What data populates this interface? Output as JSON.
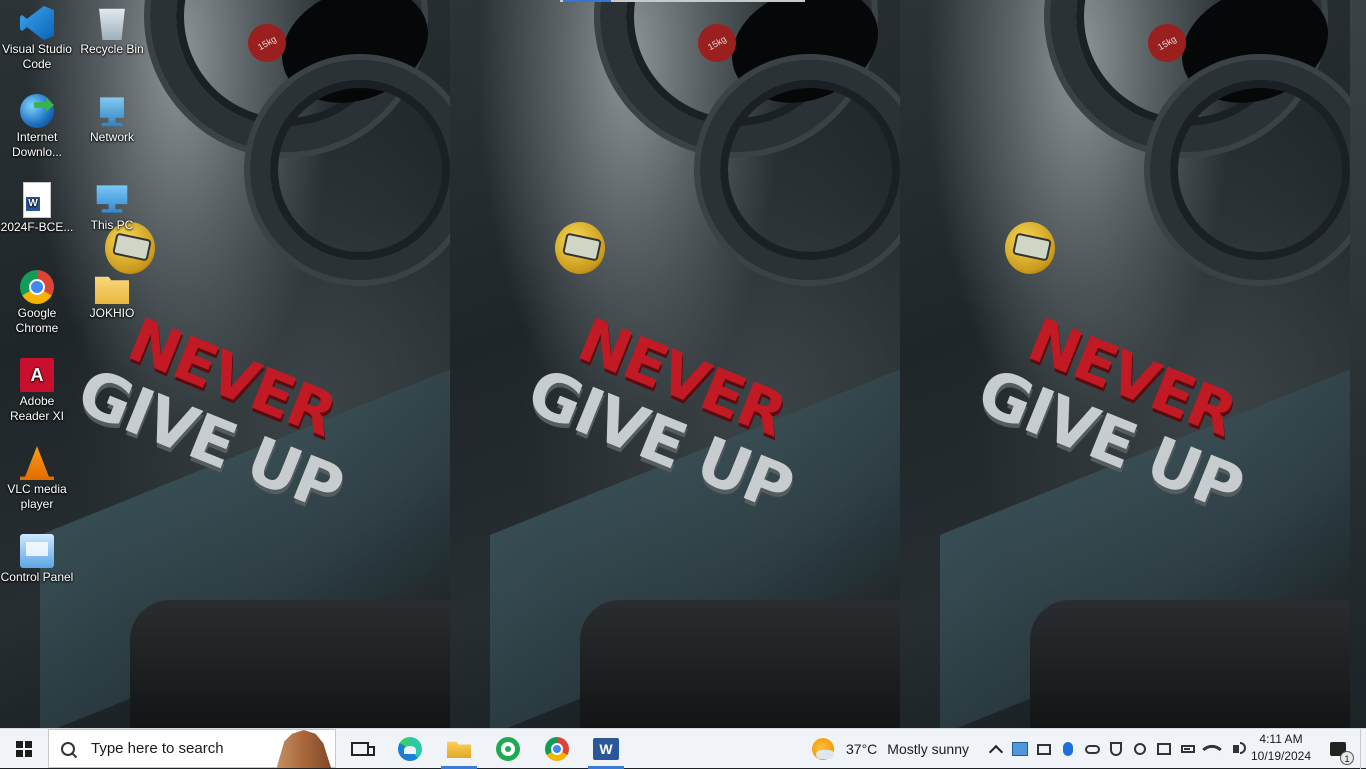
{
  "wallpaper": {
    "line1": "NEVER",
    "line2": "GIVE UP",
    "plate_label": "15kg"
  },
  "desktop_icons": [
    {
      "label": "Visual Studio Code",
      "icon": "vscode-icon"
    },
    {
      "label": "Recycle Bin",
      "icon": "recycle-bin-icon"
    },
    {
      "label": "Internet Downlo...",
      "icon": "internet-download-manager-icon"
    },
    {
      "label": "Network",
      "icon": "network-icon"
    },
    {
      "label": "2024F-BCE...",
      "icon": "word-document-icon"
    },
    {
      "label": "This PC",
      "icon": "this-pc-icon"
    },
    {
      "label": "Google Chrome",
      "icon": "chrome-icon"
    },
    {
      "label": "JOKHIO",
      "icon": "user-folder-icon"
    },
    {
      "label": "Adobe Reader XI",
      "icon": "adobe-reader-icon"
    },
    {
      "label": "VLC media player",
      "icon": "vlc-icon"
    },
    {
      "label": "Control Panel",
      "icon": "control-panel-icon"
    }
  ],
  "taskbar": {
    "search_placeholder": "Type here to search",
    "pinned_apps": [
      {
        "name": "Task View",
        "icon": "task-view-icon",
        "active": false
      },
      {
        "name": "Microsoft Edge",
        "icon": "edge-icon",
        "active": false
      },
      {
        "name": "File Explorer",
        "icon": "file-explorer-icon",
        "active": true
      },
      {
        "name": "WhatsApp",
        "icon": "whatsapp-icon",
        "active": false
      },
      {
        "name": "Google Chrome",
        "icon": "chrome-icon",
        "active": false
      },
      {
        "name": "Microsoft Word",
        "icon": "word-icon",
        "active": true
      }
    ],
    "weather": {
      "temperature": "37°C",
      "condition": "Mostly sunny",
      "icon": "sun-cloud-icon"
    },
    "tray_icons": [
      "show-hidden-icons-chevron",
      "app-tray-icon",
      "monitor-icon",
      "bluetooth-icon",
      "onedrive-icon",
      "security-shield-icon",
      "camera-icon",
      "screen-icon",
      "battery-icon",
      "wifi-icon",
      "volume-icon"
    ],
    "clock": {
      "time": "4:11 AM",
      "date": "10/19/2024"
    },
    "notification_count": "1",
    "accent_color": "#3a7bd5"
  }
}
